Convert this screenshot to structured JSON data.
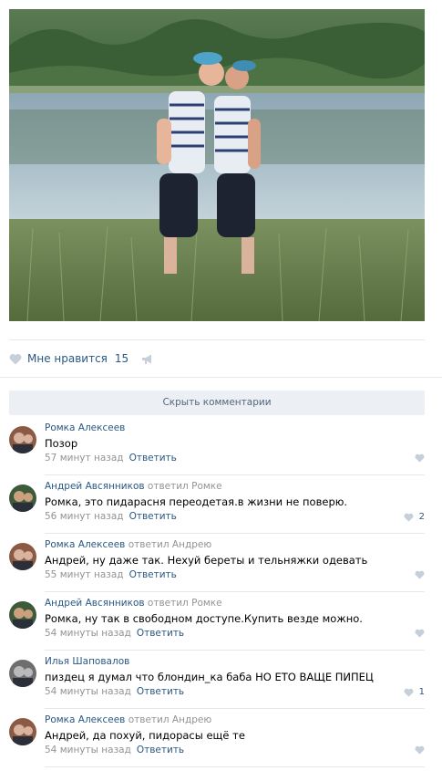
{
  "post": {
    "photo_alt": "photo",
    "likes": {
      "label": "Мне нравится",
      "count": "15"
    }
  },
  "comments_toggle": "Скрыть комментарии",
  "comments": [
    {
      "author": "Ромка Алексеев",
      "replied": "",
      "reply_to": "",
      "text": "Позор",
      "time": "57 минут назад",
      "answer": "Ответить",
      "likes": ""
    },
    {
      "author": "Андрей Авсянников",
      "replied": "ответил",
      "reply_to": "Ромке",
      "text": "Ромка, это пидарасня переодетая.в жизни не поверю.",
      "time": "56 минут назад",
      "answer": "Ответить",
      "likes": "2"
    },
    {
      "author": "Ромка Алексеев",
      "replied": "ответил",
      "reply_to": "Андрею",
      "text": "Андрей, ну даже так. Нехуй береты и тельняжки одевать",
      "time": "55 минут назад",
      "answer": "Ответить",
      "likes": ""
    },
    {
      "author": "Андрей Авсянников",
      "replied": "ответил",
      "reply_to": "Ромке",
      "text": "Ромка, ну так в свободном доступе.Купить везде можно.",
      "time": "54 минуты назад",
      "answer": "Ответить",
      "likes": ""
    },
    {
      "author": "Илья Шаповалов",
      "replied": "",
      "reply_to": "",
      "text": "пиздец я думал что блондин_ка баба НО ЕТО ВАЩЕ ПИПЕЦ",
      "time": "54 минуты назад",
      "answer": "Ответить",
      "likes": "1"
    },
    {
      "author": "Ромка Алексеев",
      "replied": "ответил",
      "reply_to": "Андрею",
      "text": "Андрей, да похуй, пидорасы ещё те",
      "time": "54 минуты назад",
      "answer": "Ответить",
      "likes": ""
    }
  ],
  "colors": {
    "link": "#2a5885",
    "muted": "#939393",
    "icon": "#c5d0db"
  }
}
